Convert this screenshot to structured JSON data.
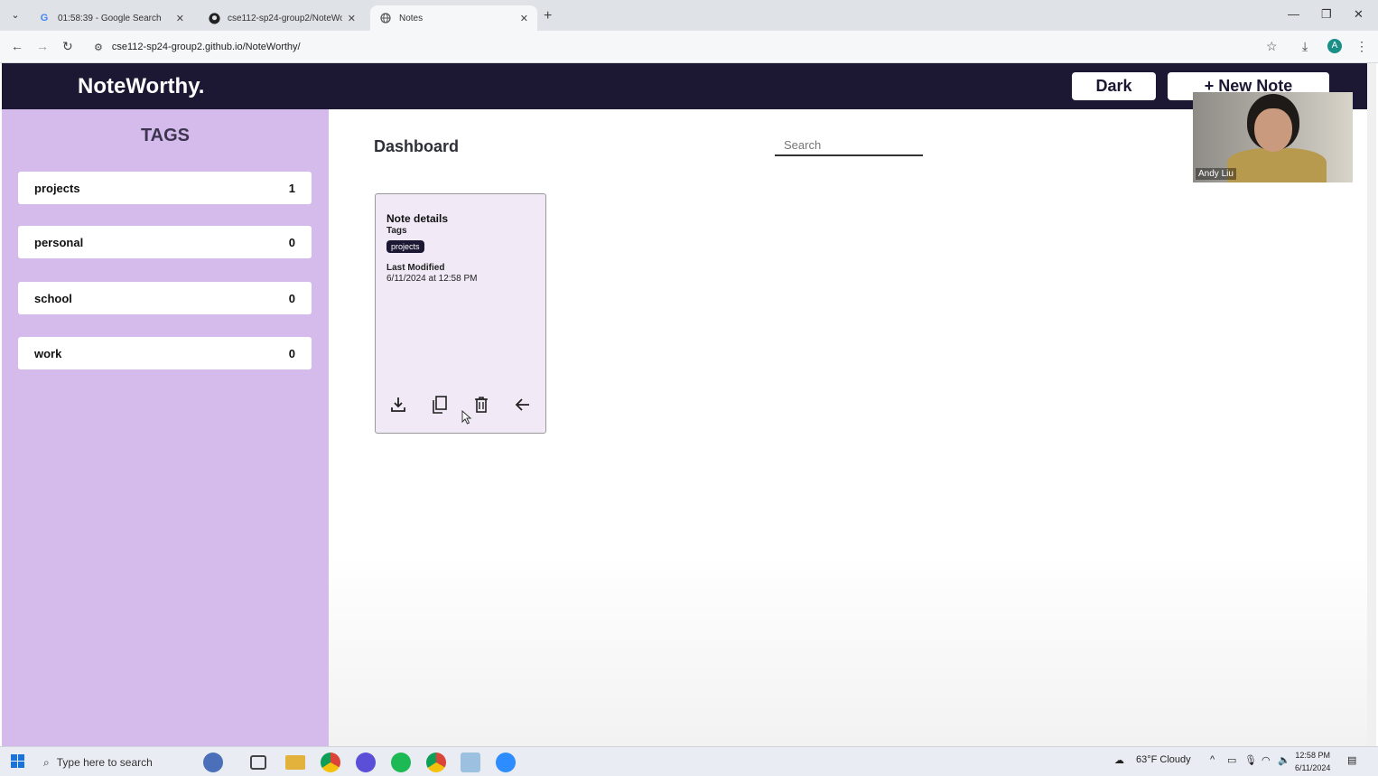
{
  "browser": {
    "tabs": [
      {
        "title": "01:58:39 - Google Search",
        "icon": "google-icon"
      },
      {
        "title": "cse112-sp24-group2/NoteWor",
        "icon": "github-icon"
      },
      {
        "title": "Notes",
        "icon": "globe-icon"
      }
    ],
    "url": "cse112-sp24-group2.github.io/NoteWorthy/",
    "profile_initial": "A"
  },
  "app": {
    "logo": "NoteWorthy.",
    "dark_button": "Dark",
    "new_note_button": "+ New Note"
  },
  "sidebar": {
    "title": "TAGS",
    "tags": [
      {
        "name": "projects",
        "count": "1"
      },
      {
        "name": "personal",
        "count": "0"
      },
      {
        "name": "school",
        "count": "0"
      },
      {
        "name": "work",
        "count": "0"
      }
    ]
  },
  "main": {
    "title": "Dashboard",
    "search_placeholder": "Search",
    "note": {
      "title": "Note details",
      "tags_label": "Tags",
      "tag": "projects",
      "modified_label": "Last Modified",
      "modified_value": "6/11/2024 at 12:58 PM"
    }
  },
  "webcam": {
    "name": "Andy Liu"
  },
  "taskbar": {
    "search_text": "Type here to search",
    "weather": "63°F  Cloudy",
    "time": "12:58 PM",
    "date": "6/11/2024"
  },
  "colors": {
    "header": "#1c1733",
    "sidebar": "#d4bbec",
    "card": "#f1e9f6"
  }
}
